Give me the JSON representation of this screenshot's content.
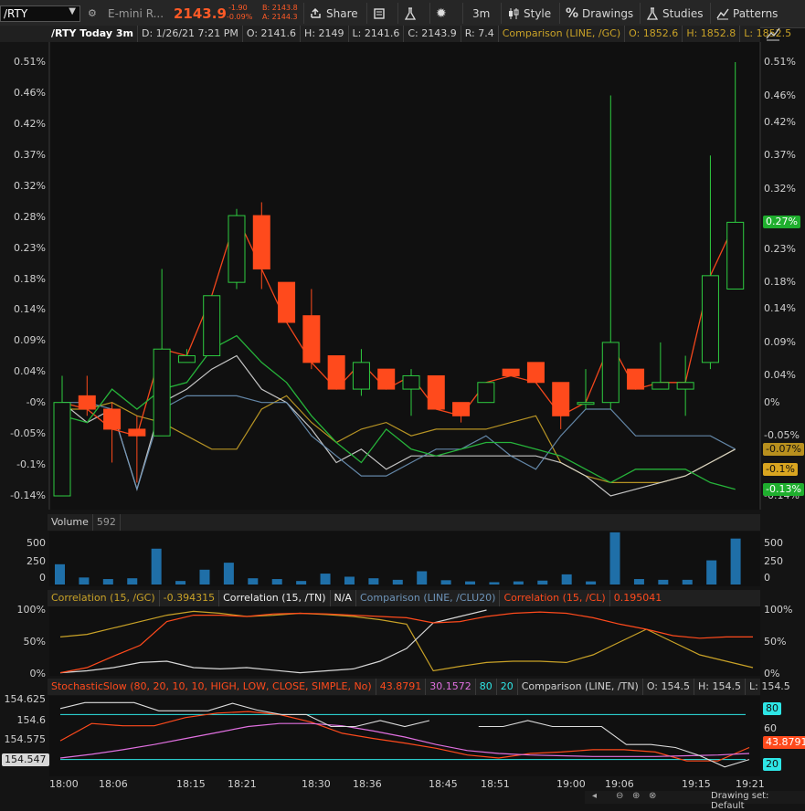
{
  "toolbar": {
    "symbol": "/RTY",
    "instrument_name": "E-mini R...",
    "last_price": "2143.9",
    "change": "-1.90",
    "change_pct": "-0.09%",
    "bid": "B: 2143.8",
    "ask": "A: 2144.3",
    "share_label": "Share",
    "timeframe": "3m",
    "style_label": "Style",
    "drawings_label": "Drawings",
    "studies_label": "Studies",
    "patterns_label": "Patterns"
  },
  "main_header": {
    "title": "/RTY Today 3m",
    "date": "D: 1/26/21 7:21 PM",
    "open": "O: 2141.6",
    "high": "H: 2149",
    "low": "L: 2141.6",
    "close": "C: 2143.9",
    "range": "R: 7.4",
    "comparison": "Comparison (LINE, /GC)",
    "cmp_open": "O: 1852.6",
    "cmp_high": "H: 1852.8",
    "cmp_low": "L: 1852.5"
  },
  "price_axis": [
    "0.51%",
    "0.46%",
    "0.42%",
    "0.37%",
    "0.32%",
    "0.28%",
    "0.23%",
    "0.18%",
    "0.14%",
    "0.09%",
    "0.04%",
    "-0%",
    "-0.05%",
    "-0.1%",
    "-0.14%"
  ],
  "right_tags": [
    {
      "text": "0.27%",
      "bg": "#1fae2e",
      "fg": "#ffffff"
    },
    {
      "text": "-0.07%",
      "bg": "#b8901e",
      "fg": "#101010"
    },
    {
      "text": "-0.1%",
      "bg": "#d9a520",
      "fg": "#101010"
    },
    {
      "text": "-0.13%",
      "bg": "#1fae2e",
      "fg": "#ffffff"
    }
  ],
  "right_axis_labels": [
    "0.51%",
    "0.46%",
    "0.42%",
    "0.37%",
    "0.32%",
    "0.23%",
    "0.18%",
    "0.14%",
    "0.09%",
    "0.04%",
    "0%",
    "-0.05%",
    "-0.14%"
  ],
  "volume": {
    "title": "Volume",
    "value": "592",
    "axis": [
      "500",
      "250",
      "0"
    ]
  },
  "correlation": {
    "gc_label": "Correlation (15, /GC)",
    "gc_value": "-0.394315",
    "tn_label": "Correlation (15, /TN)",
    "tn_value": "N/A",
    "clu_label": "Comparison (LINE, /CLU20)",
    "cl_label": "Correlation (15, /CL)",
    "cl_value": "0.195041",
    "axis": [
      "100%",
      "50%",
      "0%"
    ]
  },
  "stochastic": {
    "label": "StochasticSlow (80, 20, 10, 10, HIGH, LOW, CLOSE, SIMPLE, No)",
    "k_value": "43.8791",
    "d_value": "30.1572",
    "ob": "80",
    "os": "20",
    "cmp_label": "Comparison (LINE, /TN)",
    "o": "O: 154.5",
    "h": "H: 154.5",
    "l": "L: 154.5",
    "left_axis": [
      "154.625",
      "154.6",
      "154.575",
      "154.55"
    ],
    "left_current": "154.547",
    "right_axis": [
      "60"
    ],
    "tag_80": "80",
    "tag_k": "43.8791",
    "tag_20": "20"
  },
  "time_axis": [
    "18:00",
    "18:06",
    "18:15",
    "18:21",
    "18:30",
    "18:36",
    "18:45",
    "18:51",
    "19:00",
    "19:06",
    "19:15",
    "19:21"
  ],
  "footer": {
    "drawing_set": "Drawing set: Default"
  },
  "colors": {
    "up": "#2ecc40",
    "down": "#ff4a1c",
    "gc": "#c9a227",
    "tn": "#d8d8d8",
    "clu": "#6d93b8",
    "cl": "#ff4a1c"
  },
  "chart_data": {
    "type": "candlestick",
    "unit": "percent change",
    "candles": [
      {
        "o": -0.14,
        "c": 0.0,
        "h": 0.04,
        "l": -0.14
      },
      {
        "o": 0.01,
        "c": -0.01,
        "h": 0.04,
        "l": -0.02
      },
      {
        "o": -0.01,
        "c": -0.04,
        "h": 0.0,
        "l": -0.09
      },
      {
        "o": -0.04,
        "c": -0.05,
        "h": -0.02,
        "l": -0.12
      },
      {
        "o": -0.05,
        "c": 0.08,
        "h": 0.2,
        "l": -0.05
      },
      {
        "o": 0.06,
        "c": 0.07,
        "h": 0.08,
        "l": 0.06
      },
      {
        "o": 0.07,
        "c": 0.16,
        "h": 0.16,
        "l": 0.07
      },
      {
        "o": 0.18,
        "c": 0.28,
        "h": 0.29,
        "l": 0.17
      },
      {
        "o": 0.28,
        "c": 0.2,
        "h": 0.3,
        "l": 0.17
      },
      {
        "o": 0.18,
        "c": 0.12,
        "h": 0.18,
        "l": 0.12
      },
      {
        "o": 0.13,
        "c": 0.06,
        "h": 0.17,
        "l": 0.05
      },
      {
        "o": 0.07,
        "c": 0.02,
        "h": 0.07,
        "l": 0.02
      },
      {
        "o": 0.02,
        "c": 0.06,
        "h": 0.08,
        "l": 0.01
      },
      {
        "o": 0.05,
        "c": 0.02,
        "h": 0.05,
        "l": 0.02
      },
      {
        "o": 0.02,
        "c": 0.04,
        "h": 0.05,
        "l": -0.02
      },
      {
        "o": 0.04,
        "c": -0.01,
        "h": 0.04,
        "l": -0.01
      },
      {
        "o": 0.0,
        "c": -0.02,
        "h": 0.0,
        "l": -0.03
      },
      {
        "o": 0.0,
        "c": 0.03,
        "h": 0.03,
        "l": 0.0
      },
      {
        "o": 0.05,
        "c": 0.04,
        "h": 0.05,
        "l": 0.04
      },
      {
        "o": 0.06,
        "c": 0.03,
        "h": 0.06,
        "l": 0.03
      },
      {
        "o": 0.03,
        "c": -0.02,
        "h": 0.03,
        "l": -0.04
      },
      {
        "o": 0.0,
        "c": 0.0,
        "h": 0.05,
        "l": -0.01
      },
      {
        "o": 0.0,
        "c": 0.09,
        "h": 0.46,
        "l": -0.01
      },
      {
        "o": 0.05,
        "c": 0.02,
        "h": 0.05,
        "l": 0.02
      },
      {
        "o": 0.02,
        "c": 0.03,
        "h": 0.09,
        "l": 0.02
      },
      {
        "o": 0.02,
        "c": 0.03,
        "h": 0.07,
        "l": -0.02
      },
      {
        "o": 0.06,
        "c": 0.19,
        "h": 0.37,
        "l": 0.05
      },
      {
        "o": 0.17,
        "c": 0.27,
        "h": 0.51,
        "l": 0.17
      }
    ],
    "series": [
      {
        "name": "Comparison (LINE, /GC)",
        "values": [
          -0.01,
          -0.01,
          0.0,
          -0.02,
          -0.03,
          -0.05,
          -0.07,
          -0.07,
          -0.01,
          0.01,
          -0.03,
          -0.06,
          -0.04,
          -0.03,
          -0.05,
          -0.04,
          -0.04,
          -0.04,
          -0.03,
          -0.02,
          -0.09,
          -0.11,
          -0.12,
          -0.12,
          -0.12,
          -0.11,
          -0.09,
          -0.07
        ]
      },
      {
        "name": "/TN",
        "values": [
          0.0,
          -0.03,
          -0.01,
          -0.13,
          0.0,
          0.02,
          0.05,
          0.07,
          0.02,
          0.0,
          -0.04,
          -0.09,
          -0.07,
          -0.1,
          -0.08,
          -0.08,
          -0.08,
          -0.08,
          -0.08,
          -0.08,
          -0.09,
          -0.11,
          -0.14,
          -0.13,
          -0.12,
          -0.11,
          -0.09,
          -0.07
        ]
      },
      {
        "name": "Comparison (LINE, /CLU20)",
        "values": [
          0.0,
          0.0,
          -0.01,
          -0.13,
          -0.01,
          0.01,
          0.01,
          0.01,
          0.0,
          0.0,
          -0.05,
          -0.08,
          -0.11,
          -0.11,
          -0.09,
          -0.07,
          -0.07,
          -0.05,
          -0.08,
          -0.1,
          -0.05,
          -0.01,
          -0.01,
          -0.05,
          -0.05,
          -0.05,
          -0.05,
          -0.07
        ]
      },
      {
        "name": "/RTY",
        "values": [
          0.0,
          -0.01,
          -0.04,
          -0.05,
          0.08,
          0.07,
          0.16,
          0.28,
          0.2,
          0.12,
          0.06,
          0.02,
          0.06,
          0.02,
          0.04,
          -0.01,
          -0.02,
          0.03,
          0.04,
          0.03,
          -0.02,
          0.0,
          0.09,
          0.02,
          0.03,
          0.03,
          0.19,
          0.27
        ]
      }
    ],
    "volume_values": [
      260,
      90,
      70,
      80,
      460,
      45,
      190,
      280,
      80,
      70,
      45,
      140,
      100,
      80,
      60,
      170,
      55,
      40,
      30,
      40,
      50,
      130,
      40,
      670,
      70,
      60,
      60,
      310,
      590
    ],
    "correlation_series": [
      {
        "name": "Correlation (15, /GC)",
        "values": [
          58,
          62,
          72,
          82,
          92,
          98,
          95,
          90,
          92,
          95,
          93,
          90,
          85,
          78,
          5,
          12,
          18,
          20,
          20,
          18,
          30,
          50,
          70,
          50,
          30,
          20,
          10
        ]
      },
      {
        "name": "Correlation (15, /TN)",
        "values": [
          2,
          5,
          10,
          18,
          20,
          10,
          8,
          10,
          6,
          2,
          5,
          8,
          20,
          40,
          80,
          90,
          100
        ]
      },
      {
        "name": "Correlation (15, /CL)",
        "values": [
          2,
          10,
          28,
          45,
          82,
          92,
          92,
          90,
          94,
          95,
          94,
          92,
          90,
          88,
          80,
          82,
          90,
          95,
          97,
          95,
          88,
          78,
          70,
          60,
          56,
          58,
          58
        ]
      }
    ],
    "stochastic_series": [
      {
        "name": "%K",
        "values": [
          45,
          68,
          65,
          65,
          76,
          82,
          84,
          80,
          70,
          55,
          48,
          42,
          35,
          26,
          22,
          28,
          30,
          33,
          33,
          30,
          18,
          18,
          36
        ]
      },
      {
        "name": "%D",
        "values": [
          22,
          27,
          33,
          40,
          48,
          56,
          64,
          68,
          68,
          65,
          58,
          50,
          40,
          32,
          28,
          26,
          25,
          24,
          24,
          24,
          25,
          26,
          28
        ]
      }
    ]
  }
}
